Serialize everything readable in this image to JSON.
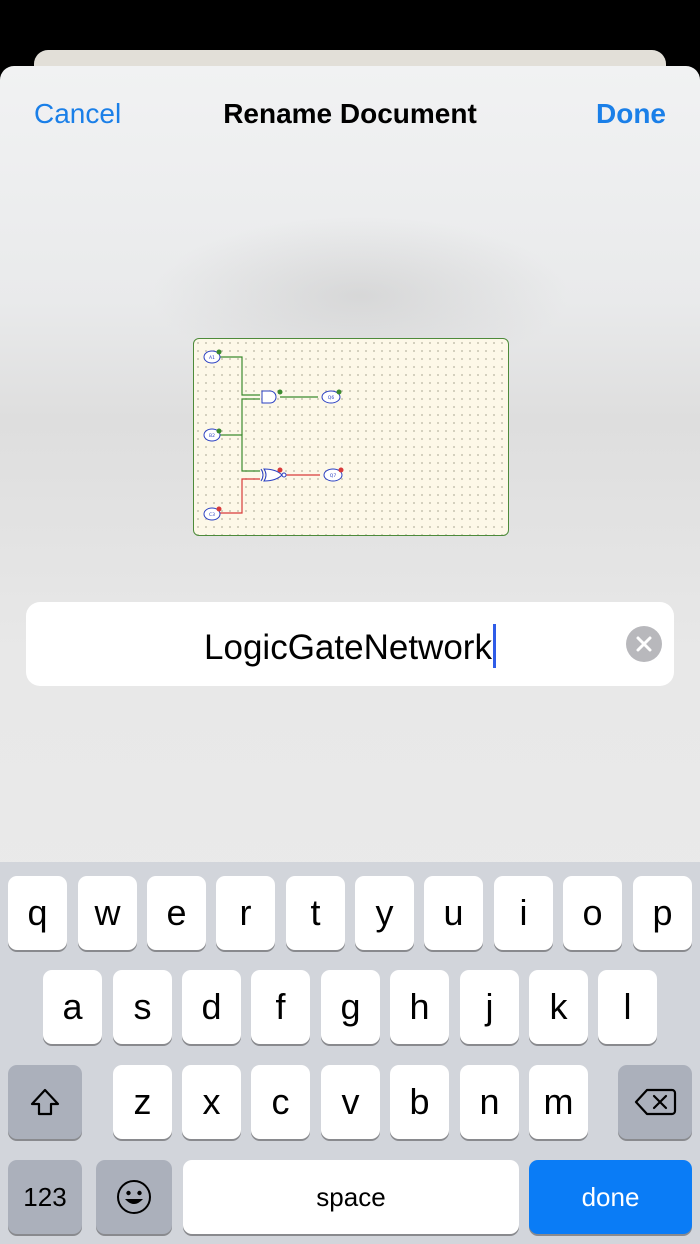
{
  "nav": {
    "cancel_label": "Cancel",
    "title": "Rename Document",
    "done_label": "Done"
  },
  "thumbnail": {
    "inputs": [
      "A1",
      "B2",
      "C3"
    ],
    "outputs": [
      "Q6",
      "Q7"
    ]
  },
  "field": {
    "value": "LogicGateNetwork"
  },
  "keyboard": {
    "row1": [
      "q",
      "w",
      "e",
      "r",
      "t",
      "y",
      "u",
      "i",
      "o",
      "p"
    ],
    "row2": [
      "a",
      "s",
      "d",
      "f",
      "g",
      "h",
      "j",
      "k",
      "l"
    ],
    "row3": [
      "z",
      "x",
      "c",
      "v",
      "b",
      "n",
      "m"
    ],
    "numbers_label": "123",
    "space_label": "space",
    "return_label": "done",
    "shift_icon": "shift-icon",
    "delete_icon": "delete-backspace-icon",
    "emoji_icon": "emoji-icon"
  },
  "colors": {
    "accent": "#1a7fe8",
    "return_key": "#0a7cf6",
    "wire_on": "#3c8a2f",
    "wire_off": "#d83a3a"
  }
}
